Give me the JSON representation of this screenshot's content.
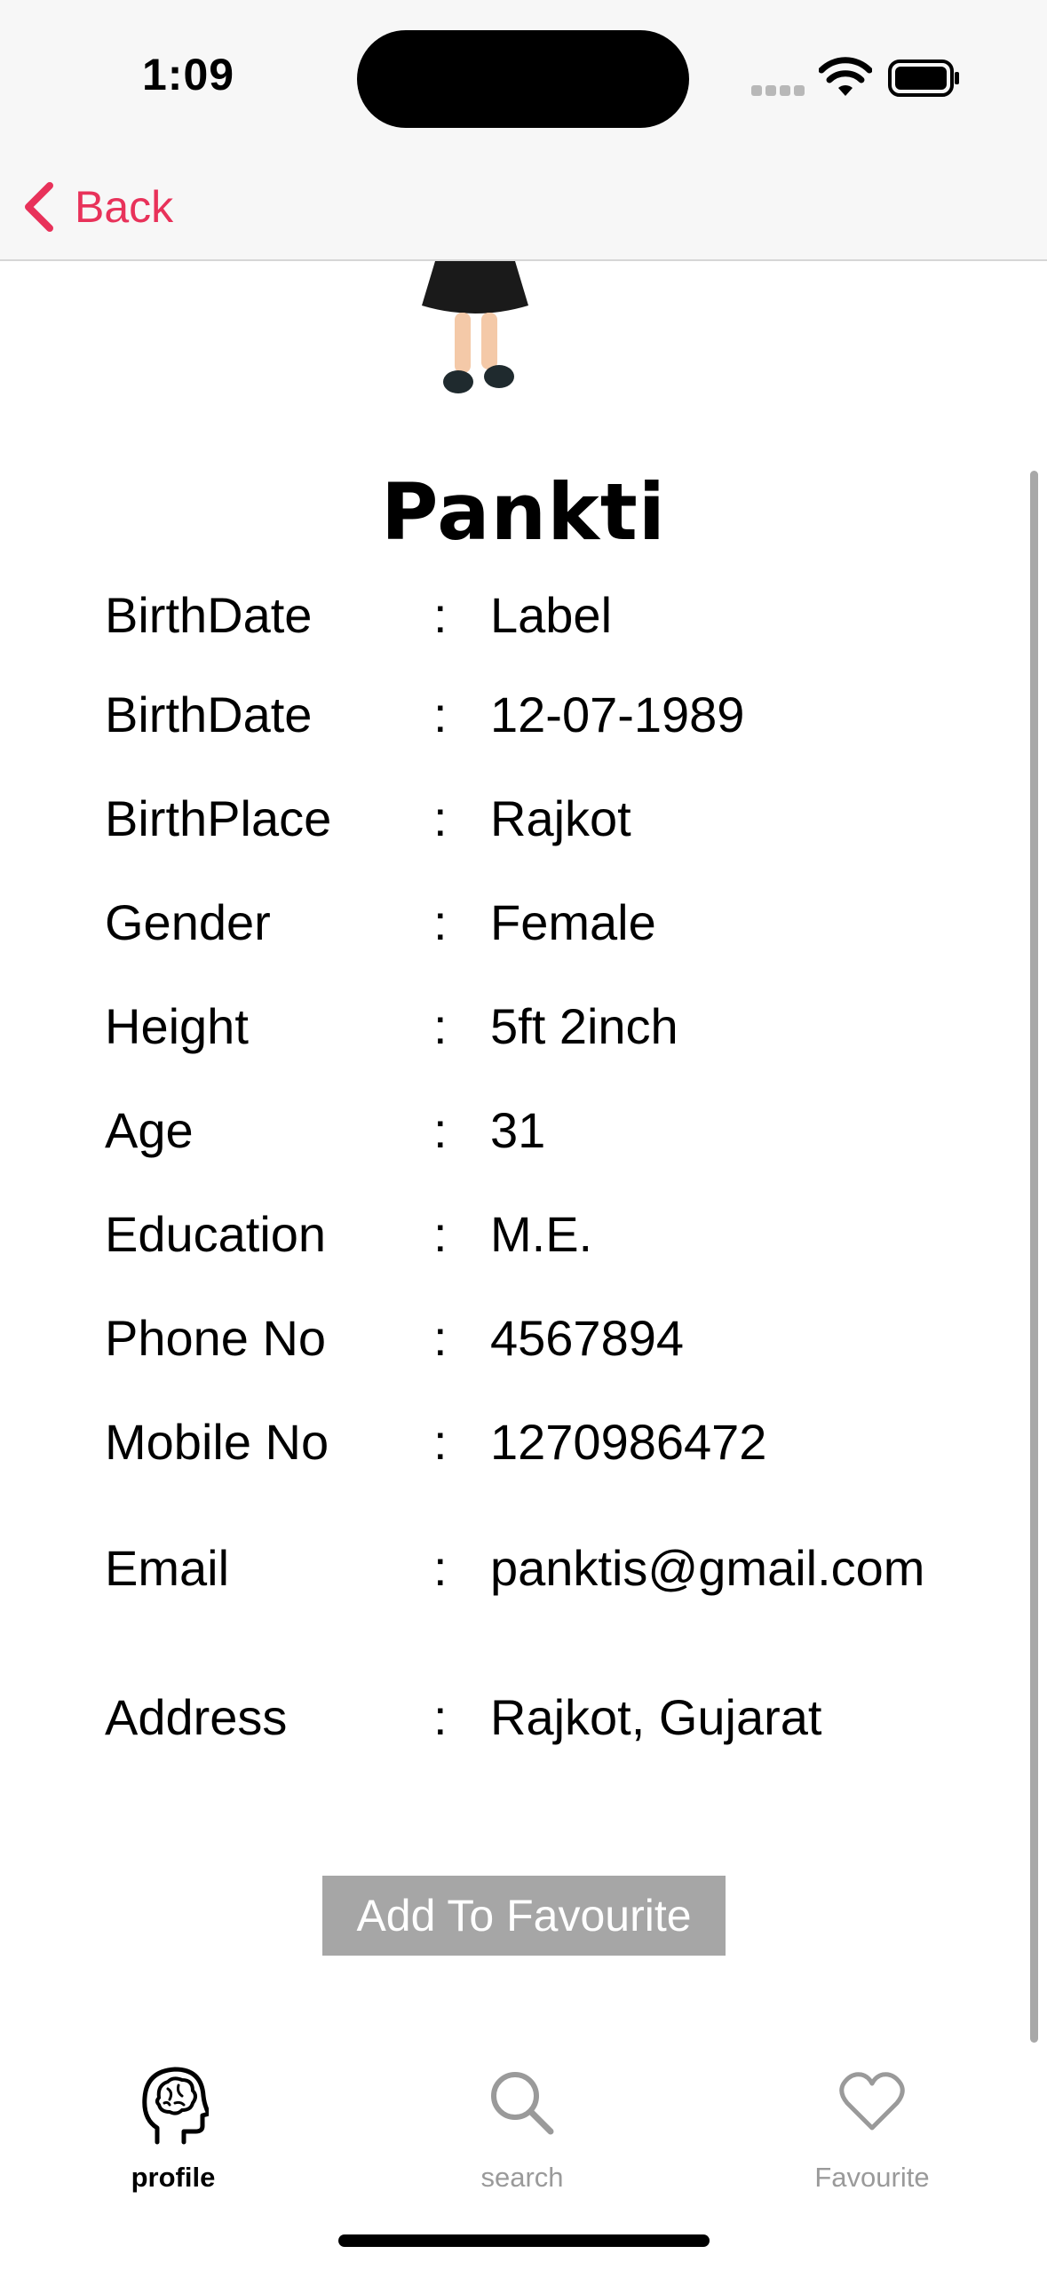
{
  "status": {
    "time": "1:09"
  },
  "nav": {
    "back_label": "Back"
  },
  "profile": {
    "name": "Pankti",
    "rows": [
      {
        "label": "BirthDate",
        "value": "Label"
      },
      {
        "label": "BirthDate",
        "value": "12-07-1989"
      },
      {
        "label": "BirthPlace",
        "value": "Rajkot"
      },
      {
        "label": "Gender",
        "value": "Female"
      },
      {
        "label": "Height",
        "value": "5ft 2inch"
      },
      {
        "label": "Age",
        "value": "31"
      },
      {
        "label": "Education",
        "value": "M.E."
      },
      {
        "label": "Phone No",
        "value": "4567894"
      },
      {
        "label": "Mobile No",
        "value": "1270986472"
      },
      {
        "label": "Email",
        "value": "panktis@gmail.com"
      },
      {
        "label": "Address",
        "value": "Rajkot, Gujarat"
      }
    ],
    "separator": ":",
    "add_favourite_label": "Add To Favourite"
  },
  "tabs": [
    {
      "label": "profile",
      "icon": "brain-head-icon",
      "selected": true
    },
    {
      "label": "search",
      "icon": "search-icon",
      "selected": false
    },
    {
      "label": "Favourite",
      "icon": "heart-icon",
      "selected": false
    }
  ],
  "colors": {
    "accent": "#e8325a",
    "button_bg": "#a6a6a6",
    "inactive_tab": "#9a9a9a"
  }
}
